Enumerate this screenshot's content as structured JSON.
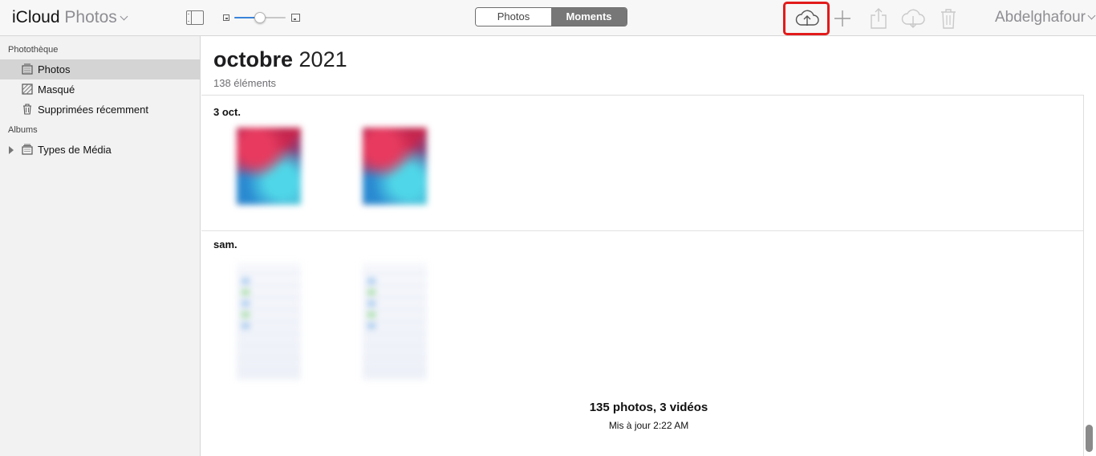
{
  "app": {
    "name_part1": "iCloud",
    "name_part2": "Photos"
  },
  "toolbar": {
    "zoom_level": 0.5,
    "segments": [
      {
        "label": "Photos",
        "selected": false
      },
      {
        "label": "Moments",
        "selected": true
      }
    ],
    "icons": [
      "cloud-upload-icon",
      "plus-icon",
      "share-icon",
      "cloud-download-icon",
      "trash-icon"
    ],
    "highlight_color": "#e21b1b",
    "user_name": "Abdelghafour"
  },
  "sidebar": {
    "library_title": "Photothèque",
    "items": [
      {
        "label": "Photos",
        "icon": "photos-library-icon",
        "selected": true
      },
      {
        "label": "Masqué",
        "icon": "hidden-icon",
        "selected": false
      },
      {
        "label": "Supprimées récemment",
        "icon": "trash-icon",
        "selected": false
      }
    ],
    "albums_title": "Albums",
    "albums": [
      {
        "label": "Types de Média",
        "icon": "album-stack-icon",
        "collapsed": true
      }
    ]
  },
  "main": {
    "month": "octobre",
    "year": "2021",
    "item_count": "138 éléments",
    "groups": [
      {
        "title": "3 oct."
      },
      {
        "title": "sam."
      }
    ],
    "summary_count": "135 photos, 3 vidéos",
    "updated": "Mis à jour 2:22 AM"
  }
}
